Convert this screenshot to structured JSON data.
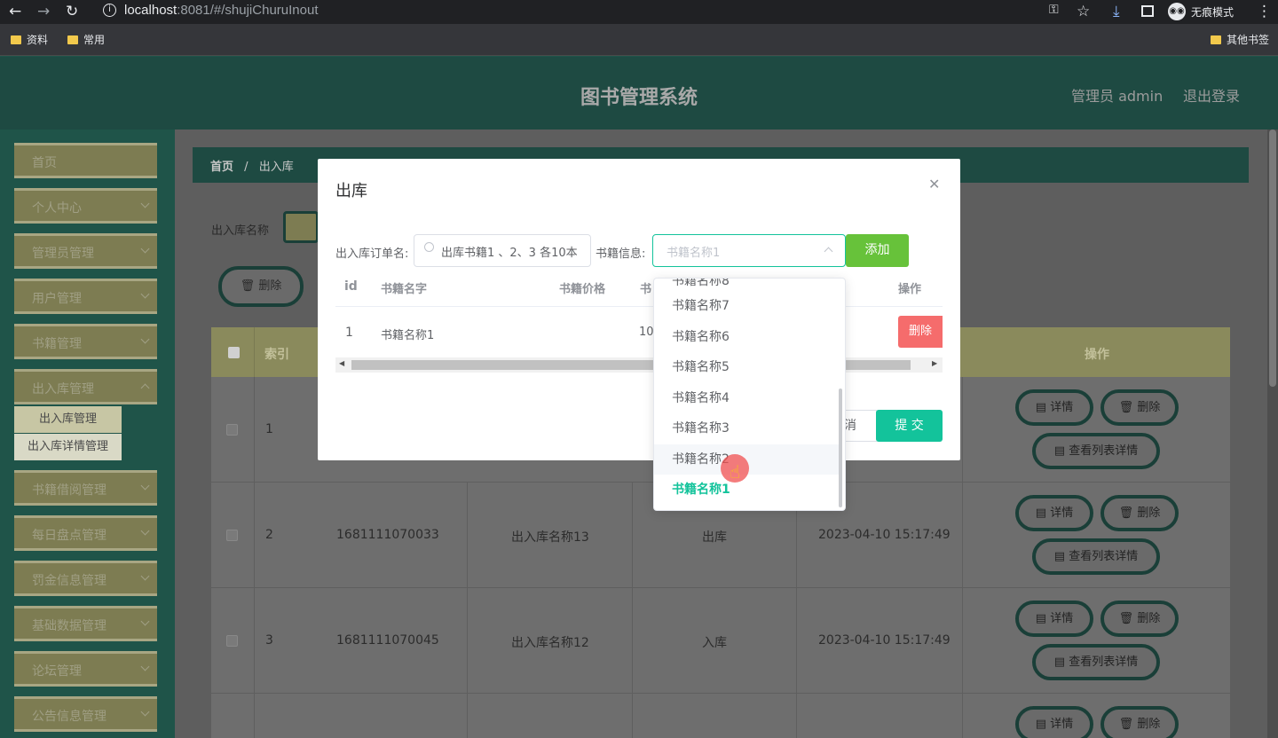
{
  "browser": {
    "url_host": "localhost",
    "url_rest": ":8081/#/shujiChuruInout",
    "incognito_label": "无痕模式",
    "bookmarks": [
      "资料",
      "常用"
    ],
    "other_bookmarks": "其他书签"
  },
  "header": {
    "title": "图书管理系统",
    "user": "管理员 admin",
    "logout": "退出登录"
  },
  "sidebar": {
    "items": [
      {
        "label": "首页"
      },
      {
        "label": "个人中心"
      },
      {
        "label": "管理员管理"
      },
      {
        "label": "用户管理"
      },
      {
        "label": "书籍管理"
      },
      {
        "label": "出入库管理"
      },
      {
        "label": "书籍借阅管理"
      },
      {
        "label": "每日盘点管理"
      },
      {
        "label": "罚金信息管理"
      },
      {
        "label": "基础数据管理"
      },
      {
        "label": "论坛管理"
      },
      {
        "label": "公告信息管理"
      }
    ],
    "subitems": [
      "出入库管理",
      "出入库详情管理"
    ]
  },
  "breadcrumb": {
    "home": "首页",
    "sep": "/",
    "current": "出入库"
  },
  "search": {
    "label": "出入库名称"
  },
  "toolbar": {
    "delete_label": "删除"
  },
  "table": {
    "headers": {
      "index": "索引",
      "actions": "操作"
    },
    "rows": [
      {
        "idx": "1",
        "code": "",
        "name": "",
        "type": "",
        "time": ""
      },
      {
        "idx": "2",
        "code": "1681111070033",
        "name": "出入库名称13",
        "type": "出库",
        "time": "2023-04-10 15:17:49"
      },
      {
        "idx": "3",
        "code": "1681111070045",
        "name": "出入库名称12",
        "type": "入库",
        "time": "2023-04-10 15:17:49"
      }
    ],
    "btn_detail": "详情",
    "btn_delete": "删除",
    "btn_list": "查看列表详情"
  },
  "dialog": {
    "title": "出库",
    "order_label": "出入库订单名:",
    "order_value": "出库书籍1 、2、3 各10本",
    "book_label": "书籍信息:",
    "book_placeholder": "书籍名称1",
    "add_label": "添加",
    "cols": {
      "id": "id",
      "name": "书籍名字",
      "price": "书籍价格",
      "partial": "书",
      "ops": "操作"
    },
    "row": {
      "id": "1",
      "name": "书籍名称1",
      "partial": "10",
      "delete": "删除"
    },
    "cancel_partial": "消",
    "submit_label": "提 交"
  },
  "dropdown": {
    "options": [
      "书籍名称7",
      "书籍名称6",
      "书籍名称5",
      "书籍名称4",
      "书籍名称3",
      "书籍名称2",
      "书籍名称1"
    ],
    "hovered": "书籍名称2",
    "selected": "书籍名称1"
  }
}
